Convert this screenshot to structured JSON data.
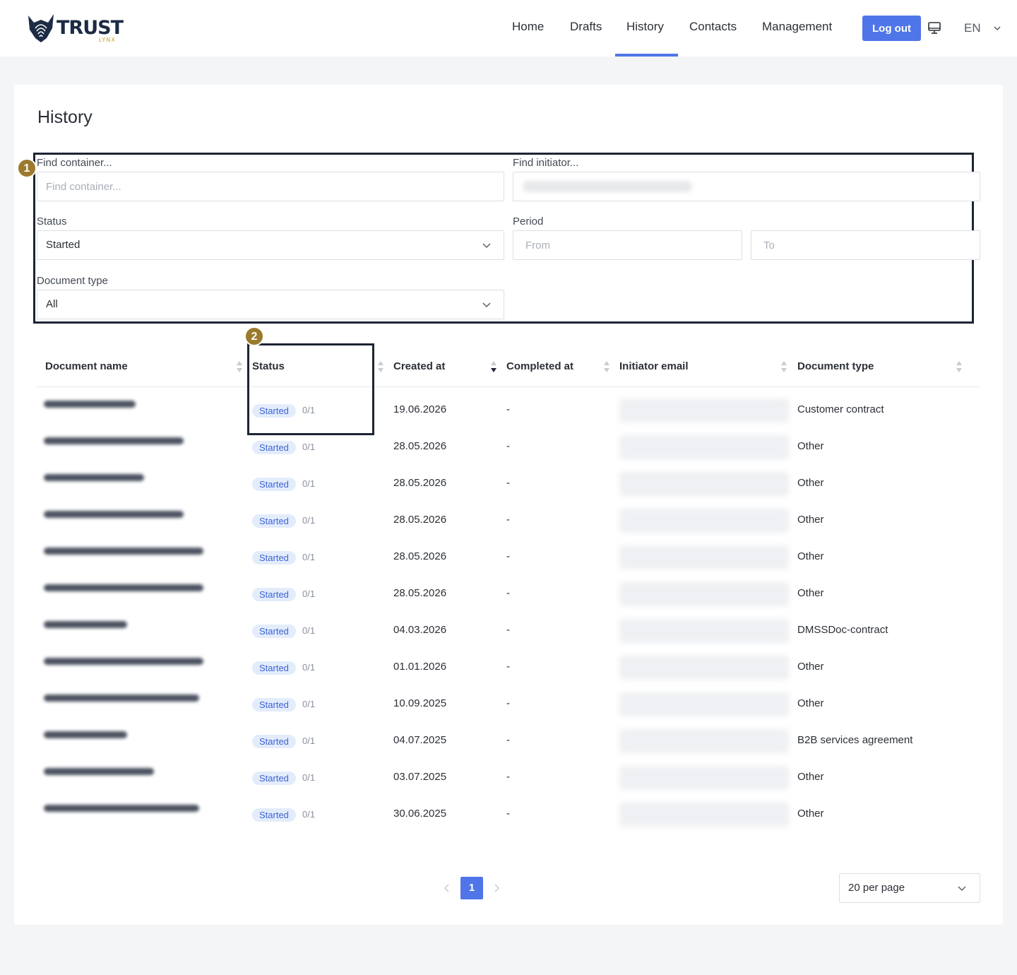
{
  "header": {
    "logo_text": "TRUST",
    "logo_sub": "LYNX",
    "nav": [
      "Home",
      "Drafts",
      "History",
      "Contacts",
      "Management"
    ],
    "active_nav": "History",
    "logout_label": "Log out",
    "language": "EN",
    "accent_color": "#4f75e8"
  },
  "page": {
    "title": "History"
  },
  "annotations": [
    "1",
    "2"
  ],
  "filters": {
    "find_container_label": "Find container...",
    "find_container_placeholder": "Find container...",
    "find_initiator_label": "Find initiator...",
    "status_label": "Status",
    "status_value": "Started",
    "period_label": "Period",
    "period_from_placeholder": "From",
    "period_to_placeholder": "To",
    "doc_type_label": "Document type",
    "doc_type_value": "All"
  },
  "table": {
    "columns": [
      "Document name",
      "Status",
      "Created at",
      "Completed at",
      "Initiator email",
      "Document type"
    ],
    "rows": [
      {
        "status": "Started",
        "progress": "0/1",
        "created": "19.06.2026",
        "completed": "-",
        "type": "Customer contract"
      },
      {
        "status": "Started",
        "progress": "0/1",
        "created": "28.05.2026",
        "completed": "-",
        "type": "Other"
      },
      {
        "status": "Started",
        "progress": "0/1",
        "created": "28.05.2026",
        "completed": "-",
        "type": "Other"
      },
      {
        "status": "Started",
        "progress": "0/1",
        "created": "28.05.2026",
        "completed": "-",
        "type": "Other"
      },
      {
        "status": "Started",
        "progress": "0/1",
        "created": "28.05.2026",
        "completed": "-",
        "type": "Other"
      },
      {
        "status": "Started",
        "progress": "0/1",
        "created": "28.05.2026",
        "completed": "-",
        "type": "Other"
      },
      {
        "status": "Started",
        "progress": "0/1",
        "created": "04.03.2026",
        "completed": "-",
        "type": "DMSSDoc-contract"
      },
      {
        "status": "Started",
        "progress": "0/1",
        "created": "01.01.2026",
        "completed": "-",
        "type": "Other"
      },
      {
        "status": "Started",
        "progress": "0/1",
        "created": "10.09.2025",
        "completed": "-",
        "type": "Other"
      },
      {
        "status": "Started",
        "progress": "0/1",
        "created": "04.07.2025",
        "completed": "-",
        "type": "B2B services agreement"
      },
      {
        "status": "Started",
        "progress": "0/1",
        "created": "03.07.2025",
        "completed": "-",
        "type": "Other"
      },
      {
        "status": "Started",
        "progress": "0/1",
        "created": "30.06.2025",
        "completed": "-",
        "type": "Other"
      }
    ]
  },
  "pagination": {
    "current_page": "1",
    "per_page": "20 per page"
  }
}
